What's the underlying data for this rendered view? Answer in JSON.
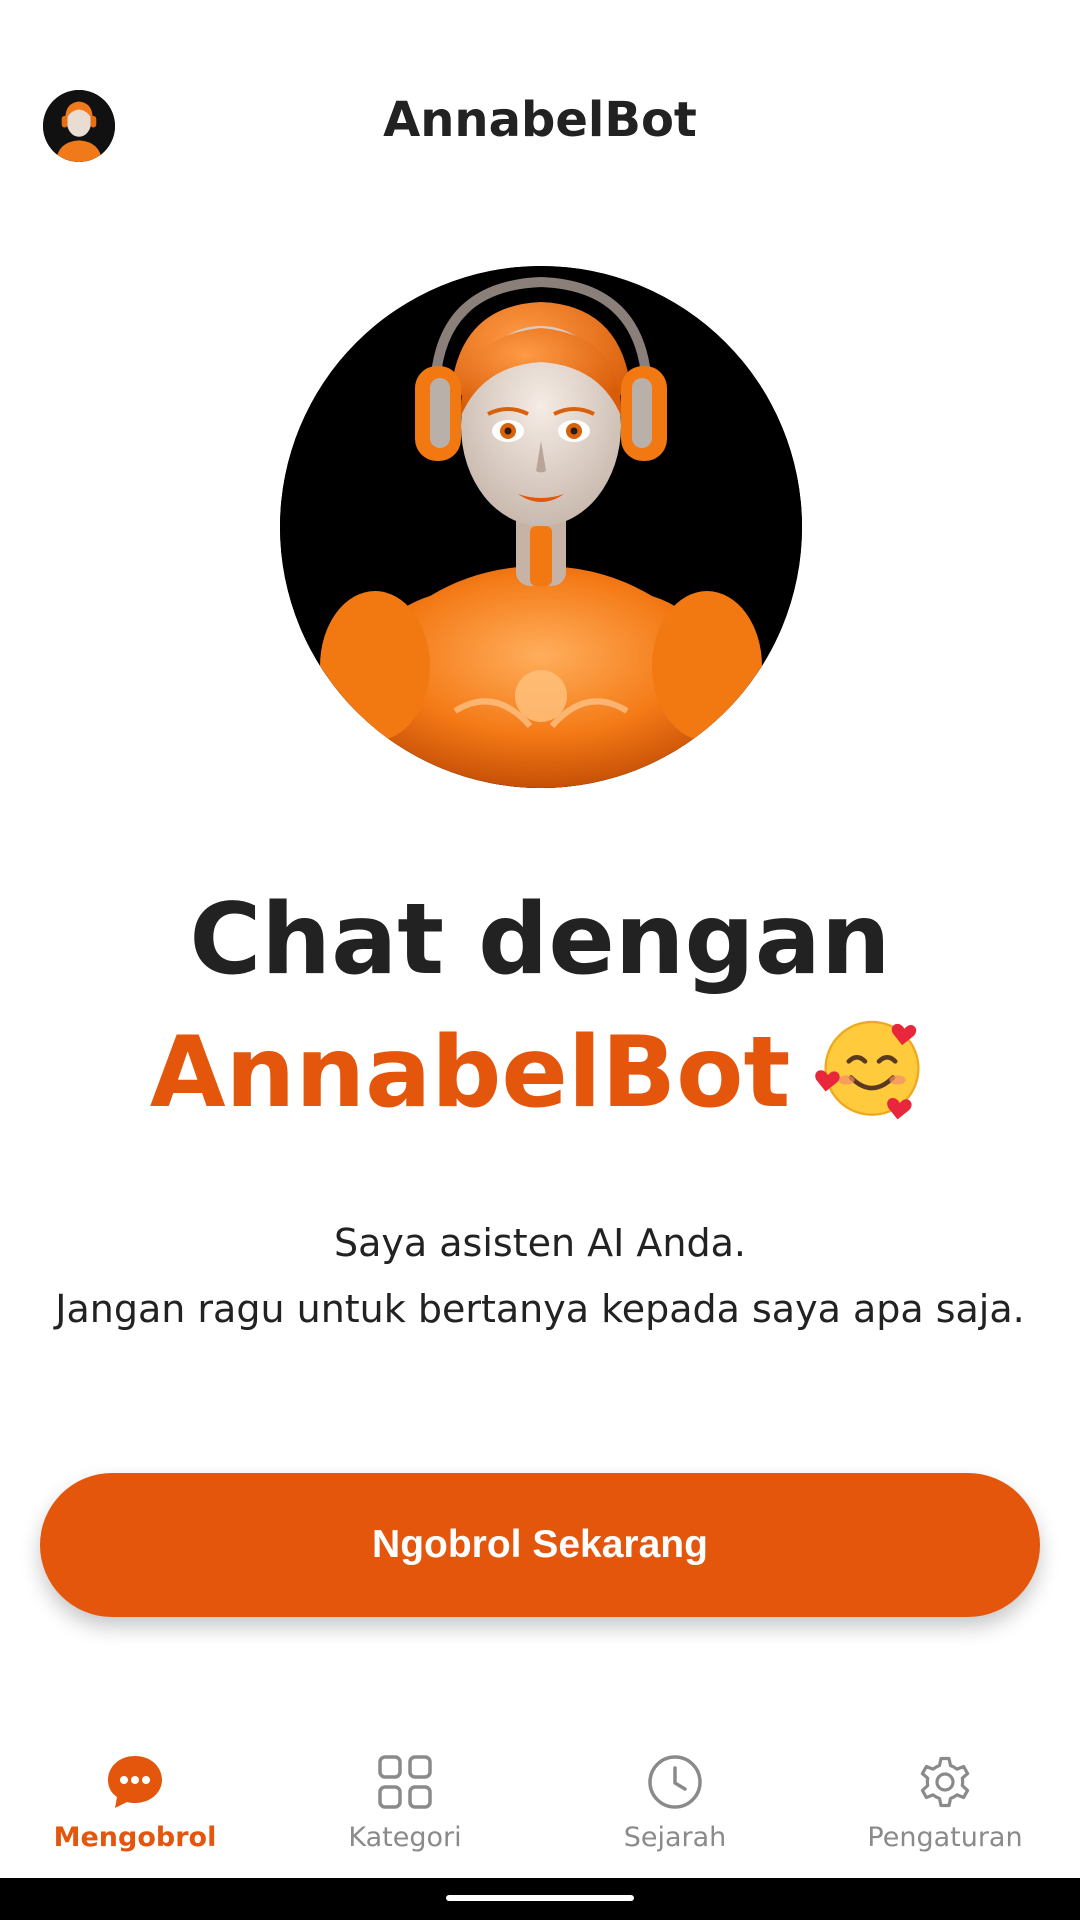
{
  "header": {
    "title": "AnnabelBot"
  },
  "hero": {
    "headline_line1": "Chat dengan",
    "headline_brand": "AnnabelBot",
    "emoji_icon": "smiling-face-with-hearts-icon"
  },
  "description": {
    "line1": "Saya asisten AI Anda.",
    "line2": "Jangan ragu untuk bertanya kepada saya apa saja."
  },
  "cta": {
    "label": "Ngobrol Sekarang"
  },
  "bottom_nav": {
    "items": [
      {
        "label": "Mengobrol",
        "icon": "chat-bubble-icon",
        "active": true
      },
      {
        "label": "Kategori",
        "icon": "grid-icon",
        "active": false
      },
      {
        "label": "Sejarah",
        "icon": "clock-icon",
        "active": false
      },
      {
        "label": "Pengaturan",
        "icon": "gear-icon",
        "active": false
      }
    ]
  },
  "colors": {
    "accent": "#e4560b",
    "text": "#222222",
    "muted": "#8a8a8a",
    "background": "#ffffff"
  }
}
